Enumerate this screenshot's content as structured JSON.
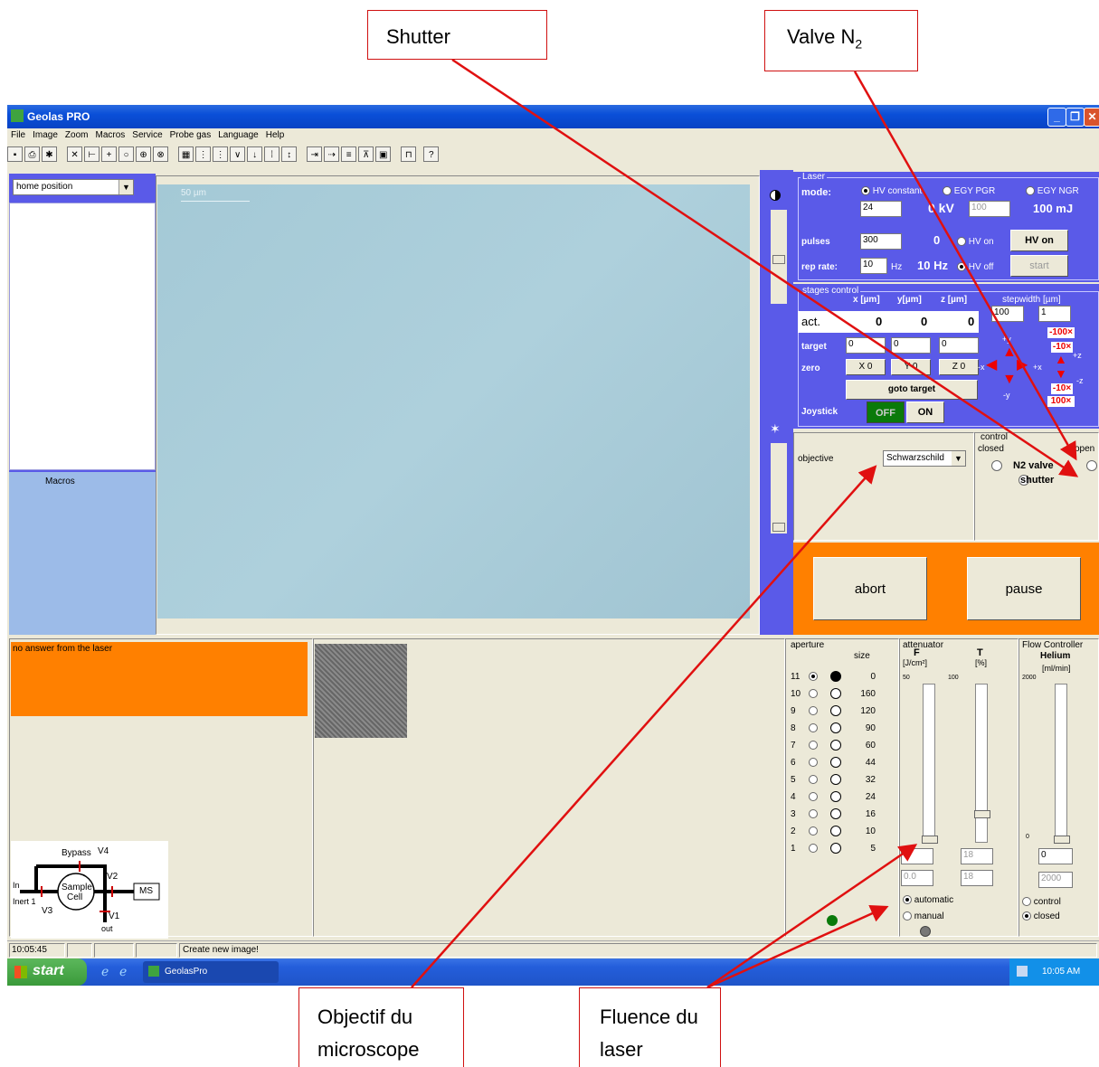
{
  "callouts": {
    "shutter": "Shutter",
    "valve_n2_prefix": "Valve N",
    "valve_n2_sub": "2",
    "objective_line1": "Objectif du",
    "objective_line2": "microscope",
    "fluence_line1": "Fluence du",
    "fluence_line2": "laser"
  },
  "window": {
    "title": "Geolas PRO",
    "menu": [
      "File",
      "Image",
      "Zoom",
      "Macros",
      "Service",
      "Probe gas",
      "Language",
      "Help"
    ]
  },
  "left": {
    "position_select": "home position",
    "macros_label": "Macros"
  },
  "image": {
    "scale_label": "50 µm"
  },
  "laser": {
    "group_label": "Laser",
    "mode_label": "mode:",
    "mode_options": [
      "HV constant",
      "EGY PGR",
      "EGY NGR"
    ],
    "hv_value": "24",
    "kv_reading": "0 kV",
    "energy_value": "100",
    "mj_reading": "100 mJ",
    "pulses_label": "pulses",
    "pulses_value": "300",
    "pulses_reading": "0",
    "hv_on_radio": "HV on",
    "hv_on_button": "HV on",
    "rep_rate_label": "rep rate:",
    "rep_rate_value": "10",
    "hz_unit": "Hz",
    "hz_reading": "10 Hz",
    "hv_off_radio": "HV off",
    "start_button": "start"
  },
  "stages": {
    "group_label": "stages control",
    "col_x": "x [µm]",
    "col_y": "y[µm]",
    "col_z": "z [µm]",
    "stepwidth_label": "stepwidth [µm]",
    "step_xy": "100",
    "step_z": "1",
    "act_label": "act.",
    "act_x": "0",
    "act_y": "0",
    "act_z": "0",
    "target_label": "target",
    "target_x": "0",
    "target_y": "0",
    "target_z": "0",
    "zero_label": "zero",
    "zero_x": "X 0",
    "zero_y": "Y 0",
    "zero_z": "Z 0",
    "goto_button": "goto target",
    "joystick_label": "Joystick",
    "joystick_off": "OFF",
    "joystick_on": "ON",
    "btn_100_up": "100",
    "btn_10_up": "10",
    "btn_10_down": "10",
    "btn_100_down": "100",
    "dir_py": "+y",
    "dir_my": "-y",
    "dir_px": "+x",
    "dir_mx": "-x",
    "dir_pz": "+z",
    "dir_mz": "-z"
  },
  "objective": {
    "label": "objective",
    "value": "Schwarzschild"
  },
  "control": {
    "group_label": "control",
    "closed_label": "closed",
    "open_label": "open",
    "n2_valve": "N2 valve",
    "shutter": "shutter"
  },
  "actions": {
    "abort": "abort",
    "pause": "pause"
  },
  "status_message": "no answer from the laser",
  "aperture": {
    "group_label": "aperture",
    "size_label": "size",
    "rows": [
      {
        "n": "11",
        "size": "0"
      },
      {
        "n": "10",
        "size": "160"
      },
      {
        "n": "9",
        "size": "120"
      },
      {
        "n": "8",
        "size": "90"
      },
      {
        "n": "7",
        "size": "60"
      },
      {
        "n": "6",
        "size": "44"
      },
      {
        "n": "5",
        "size": "32"
      },
      {
        "n": "4",
        "size": "24"
      },
      {
        "n": "3",
        "size": "16"
      },
      {
        "n": "2",
        "size": "10"
      },
      {
        "n": "1",
        "size": "5"
      }
    ],
    "selected": "11"
  },
  "attenuator": {
    "group_label": "attenuator",
    "f_label": "F",
    "f_unit": "[J/cm²]",
    "t_label": "T",
    "t_unit": "[%]",
    "f_scale_top": "50",
    "t_scale_top": "100",
    "f_value": "0",
    "f_value2": "0.0",
    "t_value": "18",
    "t_value2": "18",
    "t_slider_level": 0.18,
    "mode_auto": "automatic",
    "mode_manual": "manual"
  },
  "flow": {
    "group_label": "Flow Controller",
    "gas": "Helium",
    "unit": "[ml/min]",
    "scale_top": "2000",
    "scale_bottom": "0",
    "value": "0",
    "value2": "2000",
    "opt_control": "control",
    "opt_closed": "closed"
  },
  "gas_diagram": {
    "bypass": "Bypass",
    "v4": "V4",
    "v2": "V2",
    "v3": "V3",
    "v1": "V1",
    "in_label": "In",
    "inert_label": "Inert 1",
    "cell_line1": "Sample",
    "cell_line2": "Cell",
    "ms": "MS",
    "out": "out"
  },
  "statusbar": {
    "time": "10:05:45",
    "message": "Create new image!"
  },
  "taskbar": {
    "start": "start",
    "app": "GeolasPro",
    "clock": "10:05 AM"
  },
  "colors": {
    "orange": "#ff8000",
    "panel_blue": "#5a5ae8",
    "image_bg": "#a9ccd8",
    "callout_border": "#d01010",
    "arrow": "#e01010"
  }
}
